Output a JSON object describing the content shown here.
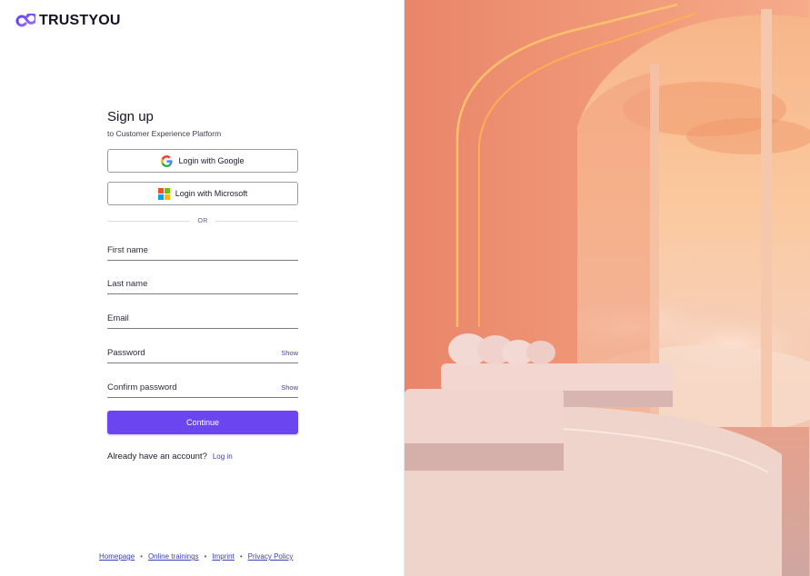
{
  "brand": {
    "name": "TRUSTYOU"
  },
  "signup": {
    "title": "Sign up",
    "subtitle": "to Customer Experience Platform",
    "google_label": "Login with Google",
    "microsoft_label": "Login with Microsoft",
    "or_label": "OR",
    "fields": {
      "first_name": "First name",
      "last_name": "Last name",
      "email": "Email",
      "password": "Password",
      "confirm_password": "Confirm password"
    },
    "show_label": "Show",
    "continue_label": "Continue",
    "have_account_text": "Already have an account?",
    "login_link": "Log in"
  },
  "footer": {
    "links": [
      "Homepage",
      "Online trainings",
      "Imprint",
      "Privacy Policy"
    ],
    "separator": "•"
  },
  "hero_image": {
    "icon": "hotel-room-sunset-image"
  },
  "colors": {
    "accent": "#6b45f0",
    "link": "#3b3fb8"
  }
}
